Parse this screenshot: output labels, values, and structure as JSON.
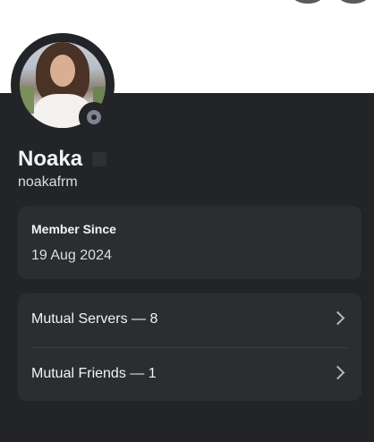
{
  "profile": {
    "display_name": "Noaka",
    "username": "noakafrm",
    "status": "offline",
    "avatar_icon": "user-avatar-photo"
  },
  "member_since": {
    "label": "Member Since",
    "date": "19 Aug 2024"
  },
  "mutuals": {
    "servers_label": "Mutual Servers — 8",
    "friends_label": "Mutual Friends — 1"
  },
  "colors": {
    "panel_bg": "#232428",
    "card_bg": "#2b2d31",
    "status_offline": "#80848e"
  }
}
